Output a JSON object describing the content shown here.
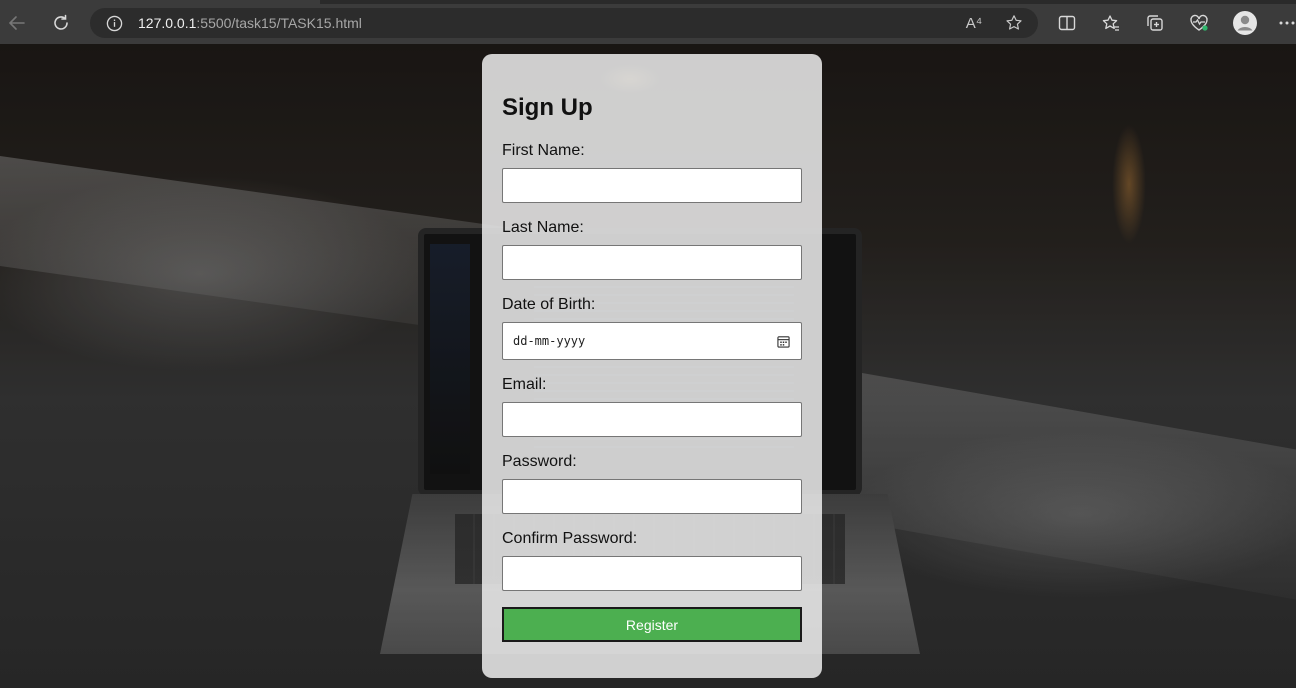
{
  "browser": {
    "url_host": "127.0.0.1",
    "url_rest": ":5500/task15/TASK15.html",
    "read_aloud_glyph": "A⁴"
  },
  "form": {
    "title": "Sign Up",
    "first_name_label": "First Name:",
    "last_name_label": "Last Name:",
    "dob_label": "Date of Birth:",
    "dob_placeholder": "dd-mm-yyyy",
    "email_label": "Email:",
    "password_label": "Password:",
    "confirm_password_label": "Confirm Password:",
    "register_label": "Register"
  },
  "colors": {
    "register_button": "#4caf50",
    "card_background": "#e8e8e8",
    "chrome": "#3b3b3b"
  }
}
